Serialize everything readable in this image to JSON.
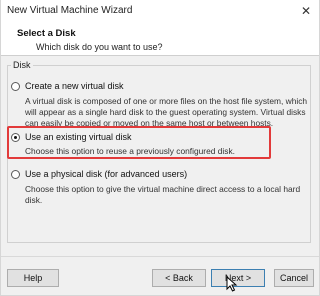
{
  "window": {
    "title": "New Virtual Machine Wizard",
    "close_glyph": "✕"
  },
  "header": {
    "title": "Select a Disk",
    "subtitle": "Which disk do you want to use?"
  },
  "group": {
    "label": "Disk"
  },
  "options": [
    {
      "label": "Create a new virtual disk",
      "desc": "A virtual disk is composed of one or more files on the host file system, which will appear as a single hard disk to the guest operating system. Virtual disks can easily be copied or moved on the same host or between hosts.",
      "selected": false
    },
    {
      "label": "Use an existing virtual disk",
      "desc": "Choose this option to reuse a previously configured disk.",
      "selected": true
    },
    {
      "label": "Use a physical disk (for advanced users)",
      "desc": "Choose this option to give the virtual machine direct access to a local hard disk.",
      "selected": false
    }
  ],
  "buttons": {
    "help": "Help",
    "back": "< Back",
    "next": "Next >",
    "cancel": "Cancel"
  },
  "colors": {
    "highlight": "#e23a3a",
    "focus_border": "#3c7fb1"
  }
}
